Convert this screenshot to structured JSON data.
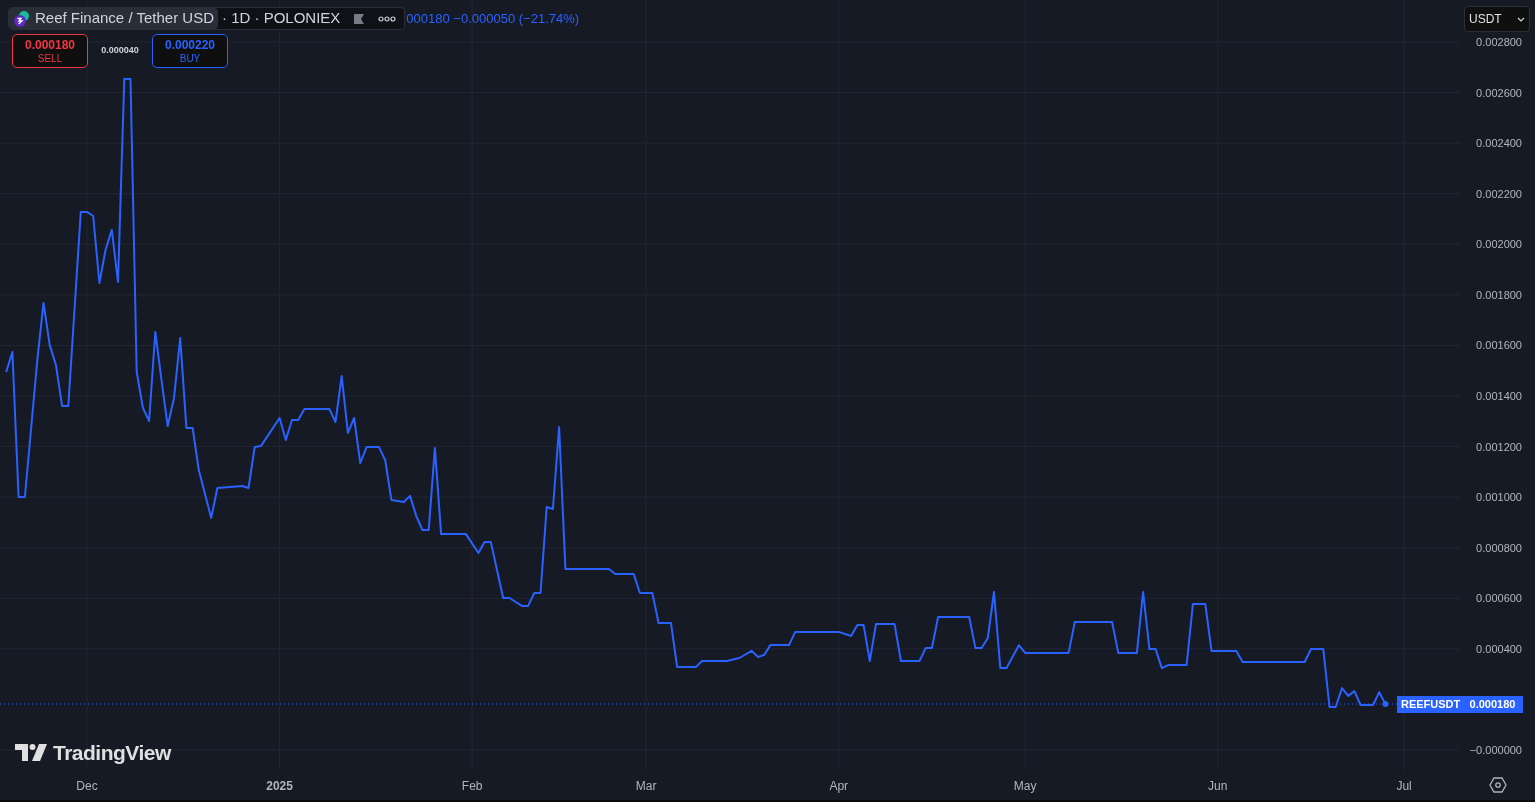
{
  "legend": {
    "title": "Reef Finance / Tether USD",
    "details": "· 1D · POLONIEX",
    "values": "000180 −0.000050 (−21.74%)"
  },
  "trade": {
    "sell": {
      "price": "0.000180",
      "label": "SELL"
    },
    "spread": "0.000040",
    "buy": {
      "price": "0.000220",
      "label": "BUY"
    }
  },
  "currency": "USDT",
  "last_price": {
    "price": "0.000180"
  },
  "logo": "TradingView",
  "chart_data": {
    "type": "line",
    "grid": true,
    "xlim": [
      "2024-11-17",
      "2025-07-10"
    ],
    "ylim": [
      -7.9e-05,
      0.002966
    ],
    "xticks": [
      {
        "value": "2024-12-01",
        "label": "Dec"
      },
      {
        "value": "2025-01-01",
        "label": "2025"
      },
      {
        "value": "2025-02-01",
        "label": "Feb"
      },
      {
        "value": "2025-03-01",
        "label": "Mar"
      },
      {
        "value": "2025-04-01",
        "label": "Apr"
      },
      {
        "value": "2025-05-01",
        "label": "May"
      },
      {
        "value": "2025-06-01",
        "label": "Jun"
      },
      {
        "value": "2025-07-01",
        "label": "Jul"
      }
    ],
    "yticks": [
      {
        "value": 0.0028,
        "label": "0.002800"
      },
      {
        "value": 0.0026,
        "label": "0.002600"
      },
      {
        "value": 0.0024,
        "label": "0.002400"
      },
      {
        "value": 0.0022,
        "label": "0.002200"
      },
      {
        "value": 0.002,
        "label": "0.002000"
      },
      {
        "value": 0.0018,
        "label": "0.001800"
      },
      {
        "value": 0.0016,
        "label": "0.001600"
      },
      {
        "value": 0.0014,
        "label": "0.001400"
      },
      {
        "value": 0.0012,
        "label": "0.001200"
      },
      {
        "value": 0.001,
        "label": "0.001000"
      },
      {
        "value": 0.0008,
        "label": "0.000800"
      },
      {
        "value": 0.0006,
        "label": "0.000600"
      },
      {
        "value": 0.0004,
        "label": "0.000400"
      },
      {
        "value": 0,
        "label": "−0.000000"
      }
    ],
    "x": [
      "2024-11-18",
      "2024-11-19",
      "2024-11-20",
      "2024-11-21",
      "2024-11-23",
      "2024-11-24",
      "2024-11-25",
      "2024-11-26",
      "2024-11-27",
      "2024-11-28",
      "2024-11-30",
      "2024-12-01",
      "2024-12-02",
      "2024-12-03",
      "2024-12-04",
      "2024-12-05",
      "2024-12-06",
      "2024-12-07",
      "2024-12-08",
      "2024-12-09",
      "2024-12-10",
      "2024-12-11",
      "2024-12-12",
      "2024-12-13",
      "2024-12-14",
      "2024-12-15",
      "2024-12-16",
      "2024-12-17",
      "2024-12-18",
      "2024-12-19",
      "2024-12-21",
      "2024-12-22",
      "2024-12-26",
      "2024-12-27",
      "2024-12-28",
      "2024-12-29",
      "2025-01-01",
      "2025-01-02",
      "2025-01-03",
      "2025-01-04",
      "2025-01-05",
      "2025-01-09",
      "2025-01-10",
      "2025-01-11",
      "2025-01-12",
      "2025-01-13",
      "2025-01-14",
      "2025-01-15",
      "2025-01-17",
      "2025-01-18",
      "2025-01-19",
      "2025-01-21",
      "2025-01-22",
      "2025-01-23",
      "2025-01-24",
      "2025-01-25",
      "2025-01-26",
      "2025-01-27",
      "2025-01-31",
      "2025-02-02",
      "2025-02-03",
      "2025-02-04",
      "2025-02-06",
      "2025-02-07",
      "2025-02-09",
      "2025-02-10",
      "2025-02-11",
      "2025-02-12",
      "2025-02-13",
      "2025-02-14",
      "2025-02-15",
      "2025-02-16",
      "2025-02-23",
      "2025-02-24",
      "2025-02-27",
      "2025-02-28",
      "2025-03-02",
      "2025-03-03",
      "2025-03-05",
      "2025-03-06",
      "2025-03-09",
      "2025-03-10",
      "2025-03-14",
      "2025-03-16",
      "2025-03-18",
      "2025-03-19",
      "2025-03-20",
      "2025-03-21",
      "2025-03-24",
      "2025-03-25",
      "2025-04-01",
      "2025-04-03",
      "2025-04-04",
      "2025-04-05",
      "2025-04-06",
      "2025-04-07",
      "2025-04-10",
      "2025-04-11",
      "2025-04-14",
      "2025-04-15",
      "2025-04-16",
      "2025-04-17",
      "2025-04-22",
      "2025-04-23",
      "2025-04-24",
      "2025-04-25",
      "2025-04-26",
      "2025-04-27",
      "2025-04-28",
      "2025-04-30",
      "2025-05-01",
      "2025-05-08",
      "2025-05-09",
      "2025-05-15",
      "2025-05-16",
      "2025-05-19",
      "2025-05-20",
      "2025-05-21",
      "2025-05-22",
      "2025-05-23",
      "2025-05-24",
      "2025-05-27",
      "2025-05-28",
      "2025-05-30",
      "2025-05-31",
      "2025-06-04",
      "2025-06-05",
      "2025-06-15",
      "2025-06-16",
      "2025-06-18",
      "2025-06-19",
      "2025-06-20",
      "2025-06-21",
      "2025-06-22",
      "2025-06-23",
      "2025-06-24",
      "2025-06-26",
      "2025-06-27",
      "2025-06-28"
    ],
    "series": [
      {
        "name": "REEFUSDT",
        "color": "#2962ff",
        "values": [
          0.001495,
          0.001574,
          0.001001,
          0.001001,
          0.001542,
          0.001768,
          0.001602,
          0.001523,
          0.001361,
          0.001361,
          0.002128,
          0.002128,
          0.002112,
          0.001847,
          0.001978,
          0.002057,
          0.001851,
          0.002654,
          0.002654,
          0.001495,
          0.001353,
          0.001301,
          0.001653,
          0.001463,
          0.001281,
          0.001392,
          0.001629,
          0.001274,
          0.001274,
          0.001107,
          0.000918,
          0.001036,
          0.001044,
          0.001036,
          0.001198,
          0.001202,
          0.001313,
          0.001226,
          0.001305,
          0.001305,
          0.001349,
          0.001349,
          0.001297,
          0.001479,
          0.001254,
          0.001313,
          0.001135,
          0.001198,
          0.001198,
          0.001147,
          0.000989,
          0.000981,
          0.001005,
          0.000925,
          0.00087,
          0.00087,
          0.001194,
          0.000854,
          0.000854,
          0.000779,
          0.000823,
          0.000823,
          0.000601,
          0.000601,
          0.00057,
          0.00057,
          0.000621,
          0.000621,
          0.000961,
          0.000953,
          0.001277,
          0.000716,
          0.000716,
          0.000696,
          0.000696,
          0.000621,
          0.000621,
          0.000502,
          0.000502,
          0.000328,
          0.000328,
          0.000352,
          0.000352,
          0.000364,
          0.000392,
          0.000368,
          0.000376,
          0.000415,
          0.000415,
          0.000467,
          0.000467,
          0.000451,
          0.000494,
          0.000494,
          0.000352,
          0.000498,
          0.000498,
          0.000352,
          0.000352,
          0.000403,
          0.000403,
          0.000526,
          0.000526,
          0.000403,
          0.000403,
          0.000443,
          0.000625,
          0.000324,
          0.000324,
          0.000415,
          0.000384,
          0.000384,
          0.000506,
          0.000506,
          0.000384,
          0.000384,
          0.000625,
          0.000399,
          0.000399,
          0.000324,
          0.000336,
          0.000336,
          0.000577,
          0.000577,
          0.000392,
          0.000392,
          0.000348,
          0.000348,
          0.000399,
          0.000399,
          0.00017,
          0.00017,
          0.000245,
          0.000214,
          0.000233,
          0.000178,
          0.000178,
          0.000229,
          0.000182
        ]
      }
    ]
  }
}
